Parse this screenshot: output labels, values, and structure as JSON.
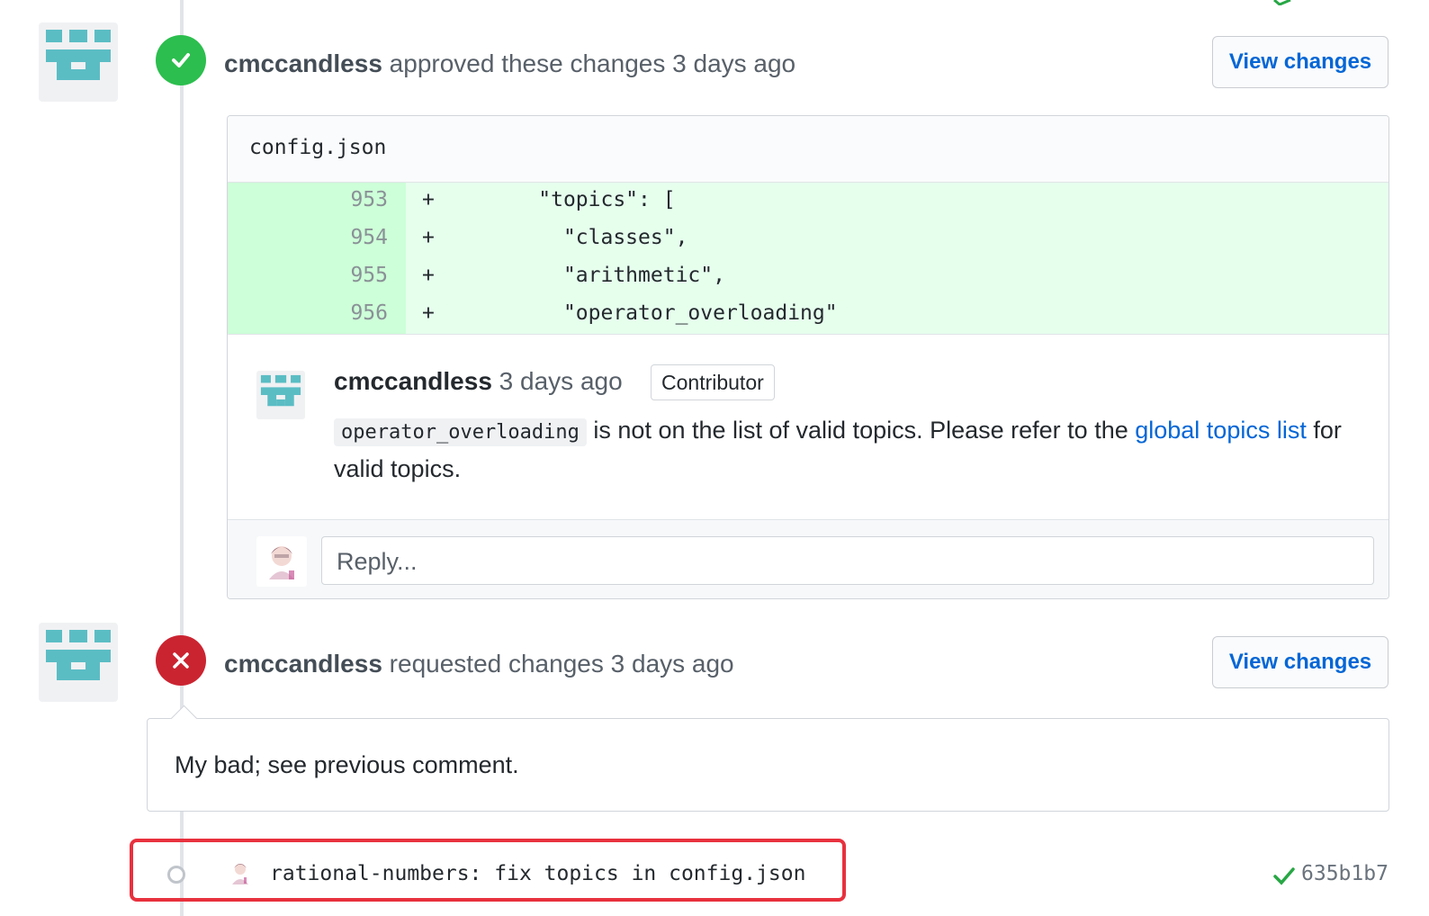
{
  "review_approved": {
    "author": "cmccandless",
    "action": "approved these changes",
    "time": "3 days ago",
    "view_changes_label": "View changes"
  },
  "diff": {
    "file_name": "config.json",
    "lines": [
      {
        "number": "953",
        "marker": "+",
        "code": "    \"topics\": ["
      },
      {
        "number": "954",
        "marker": "+",
        "code": "      \"classes\","
      },
      {
        "number": "955",
        "marker": "+",
        "code": "      \"arithmetic\","
      },
      {
        "number": "956",
        "marker": "+",
        "code": "      \"operator_overloading\""
      }
    ]
  },
  "inline_comment": {
    "author": "cmccandless",
    "time": "3 days ago",
    "role_label": "Contributor",
    "code_token": "operator_overloading",
    "text_part1": " is not on the list of valid topics. Please refer to the ",
    "link_text": "global topics list",
    "text_part2": " for valid topics."
  },
  "reply": {
    "placeholder": "Reply..."
  },
  "review_requested": {
    "author": "cmccandless",
    "action": "requested changes",
    "time": "3 days ago",
    "view_changes_label": "View changes",
    "body": "My bad; see previous comment."
  },
  "commit": {
    "message": "rational-numbers: fix topics in config.json",
    "sha": "635b1b7"
  },
  "colors": {
    "approved": "#2cbe4e",
    "requested_changes": "#cb2431",
    "link": "#0366d6",
    "highlight": "#e8313e",
    "identicon": "#5bbdc4"
  }
}
